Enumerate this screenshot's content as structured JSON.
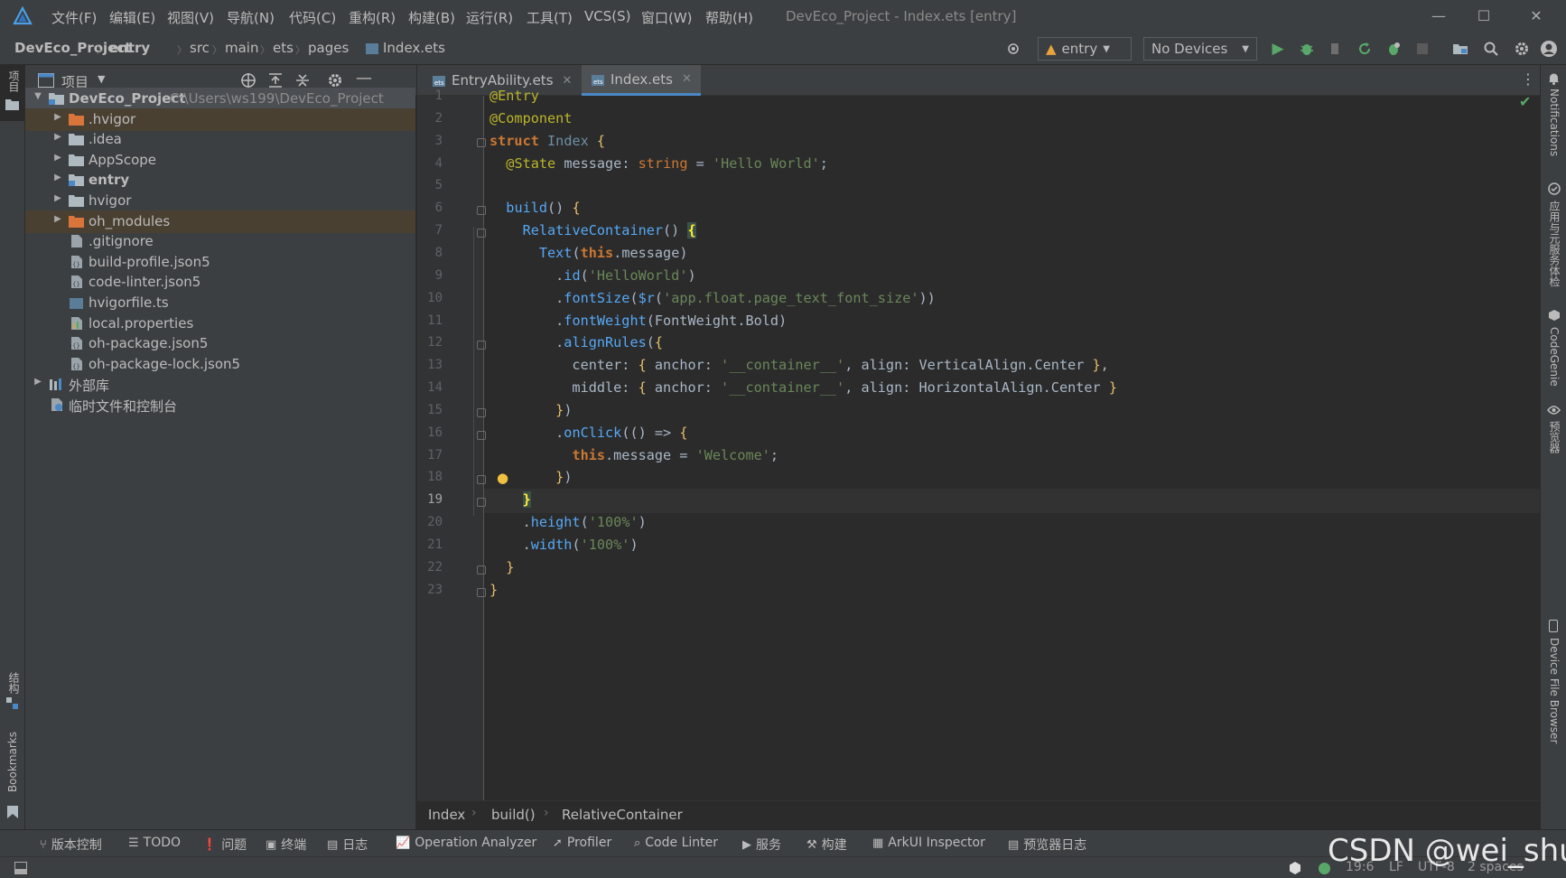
{
  "titlebar": {
    "menu": [
      "文件(F)",
      "编辑(E)",
      "视图(V)",
      "导航(N)",
      "代码(C)",
      "重构(R)",
      "构建(B)",
      "运行(R)",
      "工具(T)",
      "VCS(S)",
      "窗口(W)",
      "帮助(H)"
    ],
    "window_title": "DevEco_Project - Index.ets [entry]",
    "controls": [
      "minimize",
      "maximize",
      "close"
    ]
  },
  "navbar": {
    "breadcrumbs": [
      "DevEco_Project",
      "entry",
      "src",
      "main",
      "ets",
      "pages",
      "Index.ets"
    ],
    "run_config": "entry",
    "device": "No Devices"
  },
  "project_panel": {
    "title": "项目",
    "tree": [
      {
        "label": "DevEco_Project",
        "path": "C:\\Users\\ws199\\DevEco_Project",
        "icon": "module-folder-icon",
        "expanded": true,
        "bold": true
      },
      {
        "label": ".hvigor",
        "icon": "folder-orange-icon",
        "expandable": true
      },
      {
        "label": ".idea",
        "icon": "folder-icon",
        "expandable": true
      },
      {
        "label": "AppScope",
        "icon": "folder-icon",
        "expandable": true
      },
      {
        "label": "entry",
        "icon": "module-folder-icon",
        "expandable": true,
        "bold": true
      },
      {
        "label": "hvigor",
        "icon": "folder-icon",
        "expandable": true
      },
      {
        "label": "oh_modules",
        "icon": "folder-orange-icon",
        "expandable": true
      },
      {
        "label": ".gitignore",
        "icon": "file-icon"
      },
      {
        "label": "build-profile.json5",
        "icon": "json-file-icon"
      },
      {
        "label": "code-linter.json5",
        "icon": "json-file-icon"
      },
      {
        "label": "hvigorfile.ts",
        "icon": "ts-file-icon"
      },
      {
        "label": "local.properties",
        "icon": "properties-file-icon"
      },
      {
        "label": "oh-package.json5",
        "icon": "json-file-icon"
      },
      {
        "label": "oh-package-lock.json5",
        "icon": "json-file-icon"
      },
      {
        "label": "外部库",
        "icon": "library-icon",
        "expandable": true
      },
      {
        "label": "临时文件和控制台",
        "icon": "scratch-icon"
      }
    ]
  },
  "tabs": [
    {
      "label": "EntryAbility.ets",
      "active": false
    },
    {
      "label": "Index.ets",
      "active": true
    }
  ],
  "editor": {
    "current_line": 19,
    "line_numbers": [
      "1",
      "2",
      "3",
      "4",
      "5",
      "6",
      "7",
      "8",
      "9",
      "10",
      "11",
      "12",
      "13",
      "14",
      "15",
      "16",
      "17",
      "18",
      "19",
      "20",
      "21",
      "22",
      "23"
    ]
  },
  "editor_breadcrumb": [
    "Index",
    "build()",
    "RelativeContainer"
  ],
  "left_strip": {
    "project": "项目",
    "structure": "结构",
    "bookmarks": "Bookmarks"
  },
  "right_strip": [
    "Notifications",
    "应用与元服务体检",
    "CodeGenie",
    "预览器",
    "Device File Browser"
  ],
  "bottom_tools": [
    {
      "label": "版本控制",
      "icon": "vcs-icon"
    },
    {
      "label": "TODO",
      "icon": "todo-icon"
    },
    {
      "label": "问题",
      "icon": "problems-icon"
    },
    {
      "label": "终端",
      "icon": "terminal-icon"
    },
    {
      "label": "日志",
      "icon": "log-icon"
    },
    {
      "label": "Operation Analyzer",
      "icon": "analyzer-icon"
    },
    {
      "label": "Profiler",
      "icon": "profiler-icon"
    },
    {
      "label": "Code Linter",
      "icon": "linter-icon"
    },
    {
      "label": "服务",
      "icon": "services-icon"
    },
    {
      "label": "构建",
      "icon": "build-icon"
    },
    {
      "label": "ArkUI Inspector",
      "icon": "inspector-icon"
    },
    {
      "label": "预览器日志",
      "icon": "preview-log-icon"
    }
  ],
  "status": {
    "position": "19:6",
    "line_sep": "LF",
    "encoding": "UTF-8",
    "indent": "2 spaces"
  },
  "watermark": "CSDN @wei_shuo",
  "colors": {
    "accent": "#4a88c7",
    "run_green": "#59a869",
    "bg": "#2b2b2b",
    "panel": "#3c3f41"
  }
}
